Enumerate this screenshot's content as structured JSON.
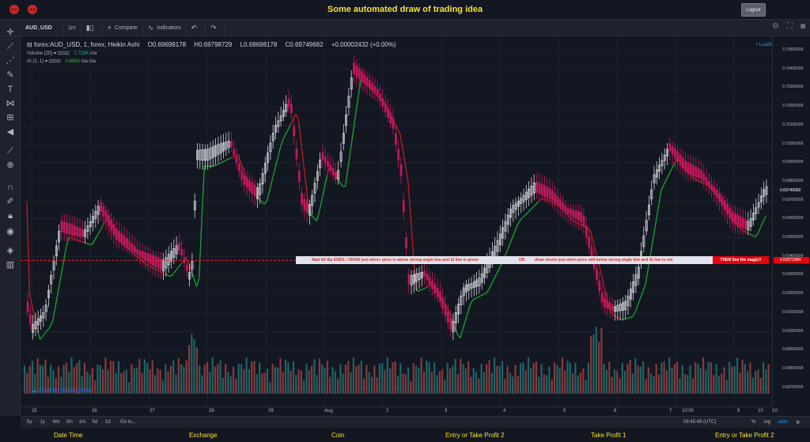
{
  "app": {
    "title": "Some automated draw of trading idea",
    "logout_label": "Logout"
  },
  "toolbar": {
    "symbol": "AUD_USD",
    "interval": "1m",
    "compare_label": "Compare",
    "indicators_label": "Indicators"
  },
  "legend": {
    "symbol_line": "forex:AUD_USD, 1, forex, Heikin Ashi",
    "open": "O0.69698178",
    "high": "H0.69798729",
    "low": "L0.69698178",
    "close": "C0.69749682",
    "change": "+0.00002432 (+0.00%)",
    "volume_label": "Volume (20)",
    "volume_value": "1.728K",
    "volume_na": "n/a",
    "ai_label": "AI (1, 1)",
    "ai_value": "0.6965",
    "ai_na1": "n/a",
    "ai_na2": "n/a",
    "loading": "Loading"
  },
  "price_scale": {
    "ticks": [
      "0.70500000",
      "0.70400000",
      "0.70300000",
      "0.70200000",
      "0.70100000",
      "0.70000000",
      "0.69900000",
      "0.69800000",
      "0.69700000",
      "0.69600000",
      "0.69500000",
      "0.69400000",
      "0.69300000",
      "0.69200000",
      "0.69100000",
      "0.69000000",
      "0.68900000",
      "0.68800000",
      "0.68700000"
    ],
    "current_price": "0.69749682",
    "marker_price": "0.69371884"
  },
  "time_scale": {
    "ticks": [
      "25",
      "26",
      "27",
      "28",
      "29",
      "Aug",
      "2",
      "3",
      "4",
      "5",
      "6",
      "7",
      "10:00",
      "9",
      "10",
      "10:"
    ]
  },
  "banner": {
    "part1": "Wait till flip ENDS  !    DRAW just when:  price is above strong angle line and AI line is green",
    "or": "OR",
    "part2": "draw shorts just when price still below strong angle line and AI line is red",
    "magic": "THEN See the magic!!"
  },
  "watermark": "Chart by TradingView",
  "bottom_bar": {
    "ranges": [
      "5y",
      "1y",
      "6m",
      "3m",
      "1m",
      "5d",
      "1d"
    ],
    "goto": "Go to...",
    "clock": "09:45:49 (UTC)",
    "percent": "%",
    "log": "log",
    "auto": "auto"
  },
  "footer": {
    "cells": [
      "Date Time",
      "Exchange",
      "Coin",
      "Entry or Take Profit 2",
      "Take Profit 1",
      "Entry or Take Profit 2"
    ]
  },
  "colors": {
    "background": "#131722",
    "title_yellow": "#f5e232",
    "bull_candle": "#ffffff",
    "bear_candle": "#c2185b",
    "ai_green": "#1b9a2f",
    "ai_red": "#b71c1c",
    "volume_green": "#26a69a",
    "volume_red": "#ef5350"
  }
}
